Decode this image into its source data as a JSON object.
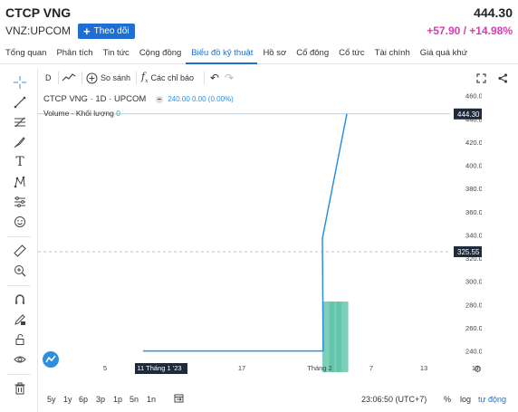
{
  "header": {
    "title": "CTCP VNG",
    "exchange": "VNZ:UPCOM",
    "follow_label": "Theo dõi",
    "price": "444.30",
    "change": "+57.90 / +14.98%"
  },
  "tabs": [
    "Tổng quan",
    "Phân tích",
    "Tin tức",
    "Cộng đồng",
    "Biểu đồ kỹ thuật",
    "Hồ sơ",
    "Cổ đông",
    "Cổ tức",
    "Tài chính",
    "Giá quá khứ"
  ],
  "toolbar": {
    "interval": "D",
    "compare": "So sánh",
    "indicators": "Các chỉ báo"
  },
  "legend": {
    "symbol": "CTCP VNG · 1D · UPCOM",
    "values": "240.00  0.00 (0.00%)",
    "volume_label": "Volume - Khối lượng",
    "volume_value": "0"
  },
  "chart_data": {
    "type": "line",
    "x": [
      "5",
      "11 Tháng 1 '23",
      "17",
      "Tháng 2",
      "7",
      "13",
      "17"
    ],
    "y_ticks": [
      "460.00",
      "440.00",
      "420.00",
      "400.00",
      "380.00",
      "360.00",
      "340.00",
      "320.00",
      "300.00",
      "280.00",
      "260.00",
      "240.00"
    ],
    "series": [
      {
        "values": [
          240.0,
          240.0,
          240.0,
          240.0,
          240.0,
          240.0,
          240.0,
          240.0,
          240.0,
          240.0,
          240.0,
          240.0,
          240.0,
          240.0,
          240.0,
          240.0,
          240.0,
          240.0,
          240.0,
          240.0,
          240.0,
          240.0,
          240.0,
          240.0,
          240.0,
          240.0,
          240.0,
          337.0,
          444.3
        ]
      }
    ],
    "volume": [
      0,
      0,
      0,
      0,
      0,
      0,
      0,
      0,
      0,
      0,
      0,
      0,
      0,
      0,
      0,
      0,
      0,
      0,
      0,
      0,
      0,
      0,
      0,
      0,
      0,
      0,
      1,
      1,
      1
    ],
    "last_price_label": "444.30",
    "crosshair_price_label": "325.55",
    "crosshair_date_label": "11 Tháng 1 '23",
    "ylim": [
      228,
      466
    ],
    "grid": false
  },
  "bottom": {
    "ranges": [
      "5y",
      "1y",
      "6p",
      "3p",
      "1p",
      "5n",
      "1n"
    ],
    "time": "23:06:50 (UTC+7)",
    "percent": "%",
    "log": "log",
    "auto": "tự động"
  },
  "colors": {
    "accent": "#1e6fd1",
    "line": "#2e8fe0",
    "volume": "#5cc3a8",
    "change": "#d63fb0"
  }
}
